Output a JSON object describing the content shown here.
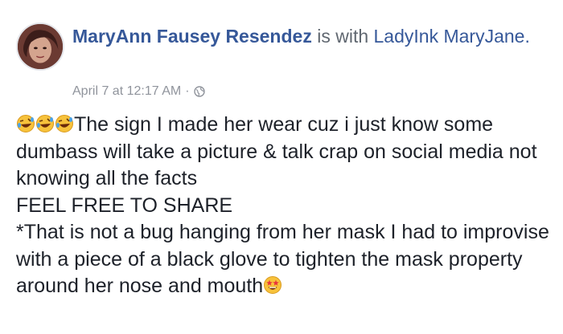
{
  "post": {
    "author_name": "MaryAnn Fausey Resendez",
    "with_text": "is with",
    "tagged_name": "LadyInk MaryJane.",
    "timestamp": "April 7 at 12:17 AM",
    "separator": "·",
    "privacy_icon": "globe-icon",
    "lines": [
      "The sign I made her wear cuz i just know some dumbass will take a picture & talk crap on social media not knowing all the facts",
      "FEEL FREE TO SHARE",
      "*That is not a bug hanging from her mask I had to improvise with a piece of a black glove to tighten the mask property around her nose and mouth"
    ],
    "emojis": {
      "leading": [
        "rolling-laughing-emoji",
        "rolling-laughing-emoji",
        "rolling-laughing-emoji"
      ],
      "trailing": "star-struck-emoji"
    },
    "colors": {
      "link": "#365899",
      "text": "#1d2129",
      "meta": "#90949c"
    }
  }
}
